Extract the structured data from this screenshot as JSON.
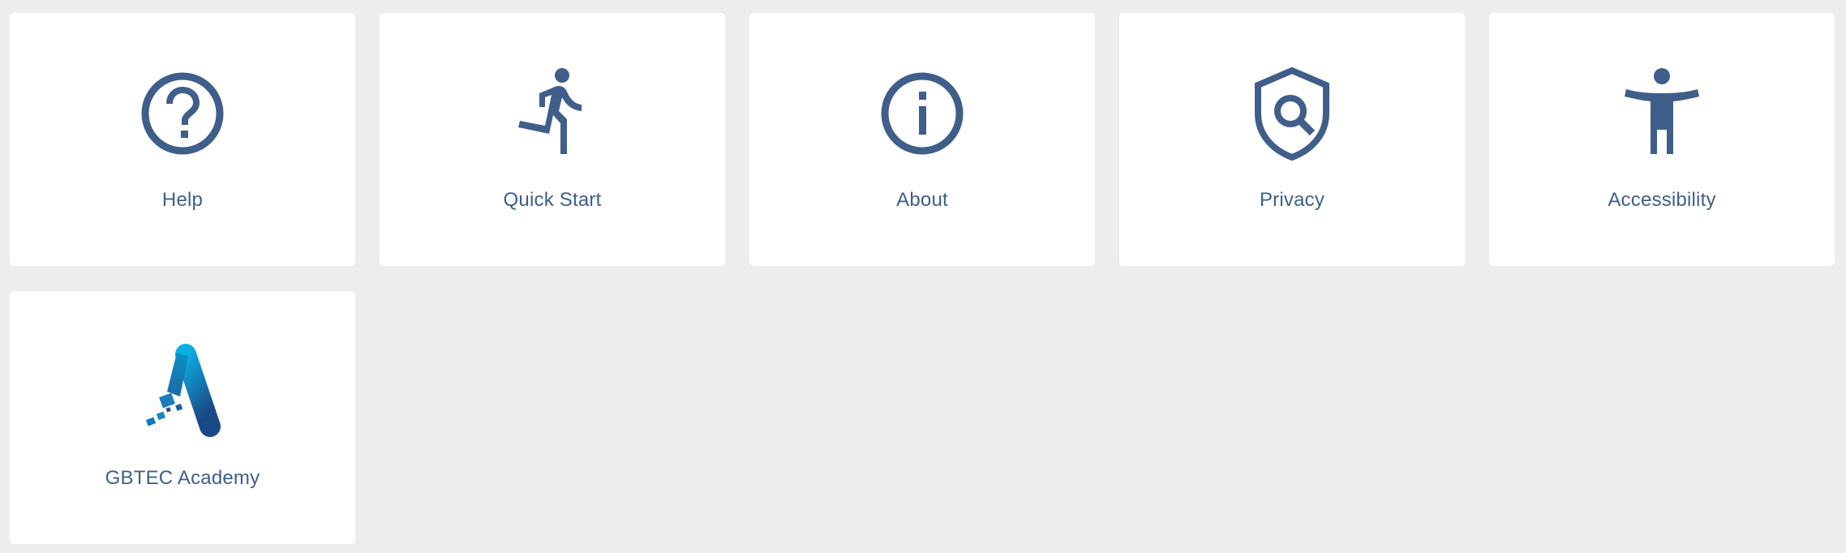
{
  "colors": {
    "background": "#ededed",
    "tile": "#ffffff",
    "accent": "#3f5e89",
    "academy_gradient_top": "#0ab0e4",
    "academy_gradient_bottom": "#1a4a86"
  },
  "tiles": [
    {
      "label": "Help",
      "icon": "help-circle-icon"
    },
    {
      "label": "Quick Start",
      "icon": "running-person-icon"
    },
    {
      "label": "About",
      "icon": "info-circle-icon"
    },
    {
      "label": "Privacy",
      "icon": "shield-search-icon"
    },
    {
      "label": "Accessibility",
      "icon": "accessibility-person-icon"
    },
    {
      "label": "GBTEC Academy",
      "icon": "gbtec-academy-logo-icon"
    }
  ]
}
